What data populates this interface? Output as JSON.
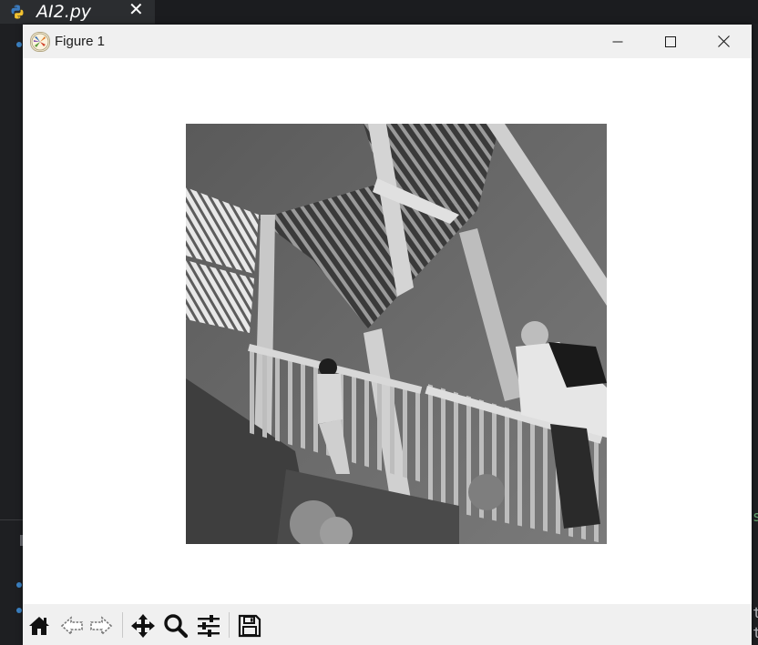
{
  "editor": {
    "tab_title": "AI2.py",
    "right_glyphs": [
      "s",
      "t",
      "t"
    ],
    "colors": {
      "background": "#1e1f22",
      "tab_active": "#2b2d30"
    }
  },
  "window": {
    "title": "Figure 1",
    "app_icon": "matplotlib-logo-icon",
    "controls": [
      "minimize-icon",
      "maximize-icon",
      "close-icon"
    ],
    "colors": {
      "titlebar": "#f0f0f0",
      "canvas": "#ffffff",
      "toolbar": "#f0f0f0"
    }
  },
  "figure": {
    "image": "grayscale photo of people climbing an outdoor staircase tower",
    "colormap": "gray"
  },
  "toolbar": {
    "tools": [
      {
        "name": "home-icon"
      },
      {
        "name": "back-arrow-icon"
      },
      {
        "name": "forward-arrow-icon"
      },
      {
        "name": "pan-icon"
      },
      {
        "name": "zoom-icon"
      },
      {
        "name": "subplots-config-icon"
      },
      {
        "name": "save-icon"
      }
    ]
  }
}
